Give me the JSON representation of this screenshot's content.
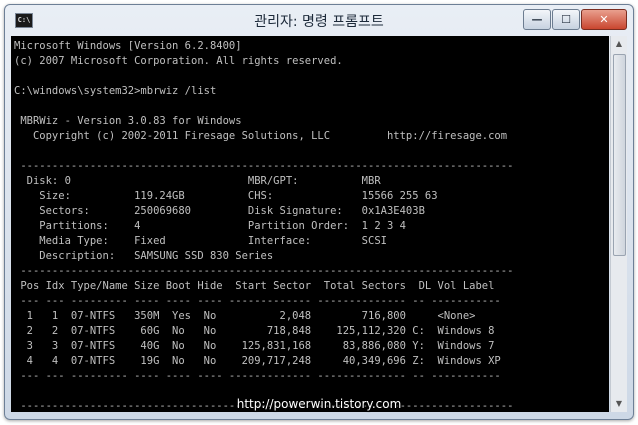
{
  "window": {
    "icon_label": "C:\\",
    "title": "관리자: 명령 프롬프트",
    "minimize_glyph": "—",
    "maximize_glyph": "☐",
    "close_glyph": "✕"
  },
  "console": {
    "lines": [
      "Microsoft Windows [Version 6.2.8400]",
      "(c) 2007 Microsoft Corporation. All rights reserved.",
      "",
      "C:\\windows\\system32>mbrwiz /list",
      "",
      " MBRWiz - Version 3.0.83 for Windows",
      "   Copyright (c) 2002-2011 Firesage Solutions, LLC         http://firesage.com",
      "",
      " ------------------------------------------------------------------------------",
      "  Disk: 0                            MBR/GPT:          MBR",
      "    Size:          119.24GB          CHS:              15566 255 63",
      "    Sectors:       250069680         Disk Signature:   0x1A3E403B",
      "    Partitions:    4                 Partition Order:  1 2 3 4",
      "    Media Type:    Fixed             Interface:        SCSI",
      "    Description:   SAMSUNG SSD 830 Series",
      " ------------------------------------------------------------------------------",
      " Pos Idx Type/Name Size Boot Hide  Start Sector  Total Sectors  DL Vol Label",
      " --- --- --------- ---- ---- ---- ------------- -------------- -- -----------",
      "  1   1  07-NTFS   350M  Yes  No          2,048        716,800     <None>",
      "  2   2  07-NTFS    60G  No   No        718,848    125,112,320 C:  Windows 8",
      "  3   3  07-NTFS    40G  No   No    125,831,168     83,886,080 Y:  Windows 7",
      "  4   4  07-NTFS    19G  No   No    209,717,248     40,349,696 Z:  Windows XP",
      " --- --- --------- ---- ---- ---- ------------- -------------- -- -----------",
      "",
      " ------------------------------------------------------------------------------"
    ]
  },
  "scrollbar": {
    "up_glyph": "▲",
    "down_glyph": "▼"
  },
  "watermark": "http://powerwin.tistory.com"
}
